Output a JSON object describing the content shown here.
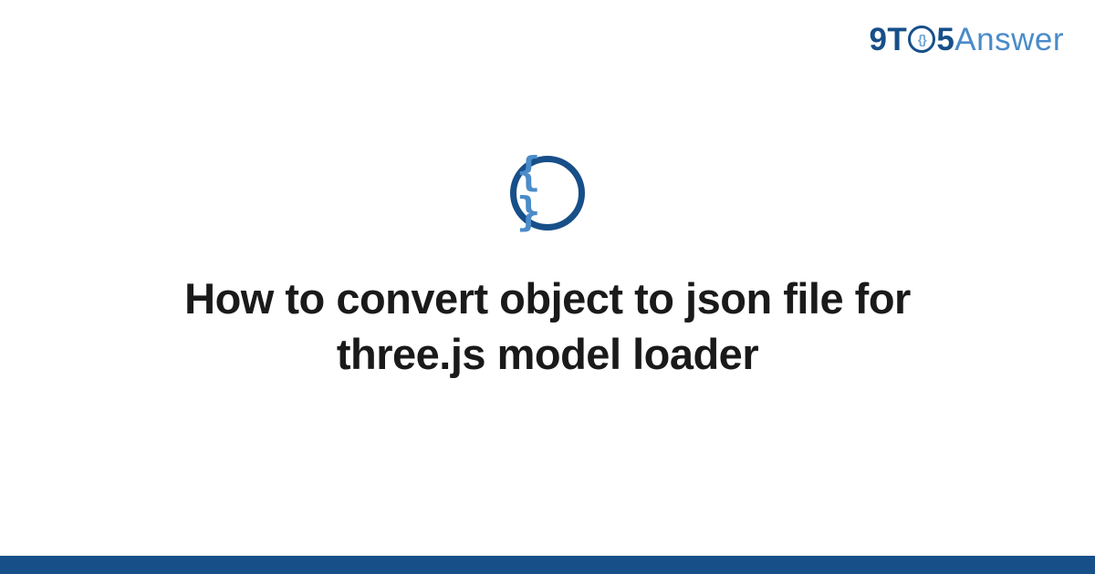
{
  "logo": {
    "part1": "9T",
    "circle_inner": "{}",
    "part2": "5",
    "part3": "Answer"
  },
  "icon": {
    "braces": "{ }"
  },
  "title": "How to convert object to json file for three.js model loader"
}
